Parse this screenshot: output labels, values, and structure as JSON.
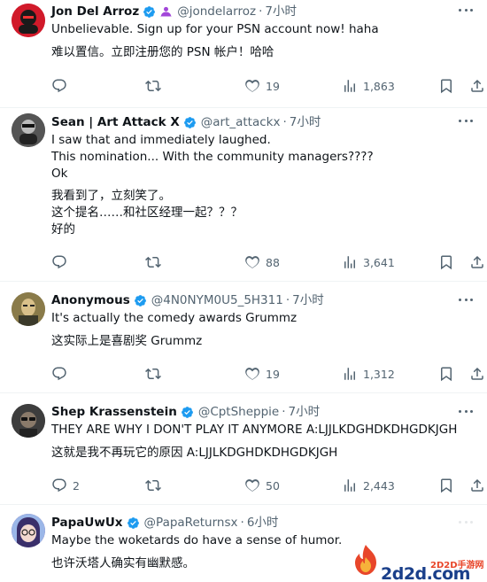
{
  "tweets": [
    {
      "name": "Jon Del Arroz",
      "handle": "@jondelarroz",
      "time": "7小时",
      "lines_en": [
        "Unbelievable.  Sign up for your PSN account now! haha"
      ],
      "lines_zh": [
        "难以置信。立即注册您的 PSN 帐户！哈哈"
      ],
      "replies": "",
      "retweets": "",
      "likes": "19",
      "views": "1,863"
    },
    {
      "name": "Sean | Art Attack X",
      "handle": "@art_attackx",
      "time": "7小时",
      "lines_en": [
        "I saw that and immediately laughed.",
        "This nomination... With the community managers????",
        "Ok"
      ],
      "lines_zh": [
        "我看到了，立刻笑了。",
        "这个提名……和社区经理一起？？？",
        "好的"
      ],
      "replies": "",
      "retweets": "",
      "likes": "88",
      "views": "3,641"
    },
    {
      "name": "Anonymous",
      "handle": "@4N0NYM0U5_5H311",
      "time": "7小时",
      "lines_en": [
        "It's actually the comedy awards Grummz"
      ],
      "lines_zh": [
        "这实际上是喜剧奖 Grummz"
      ],
      "replies": "",
      "retweets": "",
      "likes": "19",
      "views": "1,312"
    },
    {
      "name": "Shep Krassenstein",
      "handle": "@CptSheppie",
      "time": "7小时",
      "lines_en": [
        "THEY ARE WHY I DON'T PLAY IT ANYMORE A:LJJLKDGHDKDHGDKJGH"
      ],
      "lines_zh": [
        "这就是我不再玩它的原因 A:LJJLKDGHDKDHGDKJGH"
      ],
      "replies": "2",
      "retweets": "",
      "likes": "50",
      "views": "2,443"
    },
    {
      "name": "PapaUwUx",
      "handle": "@PapaReturnsx",
      "time": "6小时",
      "lines_en": [
        "Maybe the woketards do have a sense of humor."
      ],
      "lines_zh": [
        "也许沃塔人确实有幽默感。"
      ],
      "replies": "",
      "retweets": "",
      "likes": "",
      "views": ""
    }
  ],
  "watermark": {
    "text": "2d2d.com",
    "subtext": "2D2D手游网"
  },
  "colors": {
    "verified": "#1d9bf0",
    "affiliate": "#a246d9",
    "secondary_text": "#536471"
  }
}
